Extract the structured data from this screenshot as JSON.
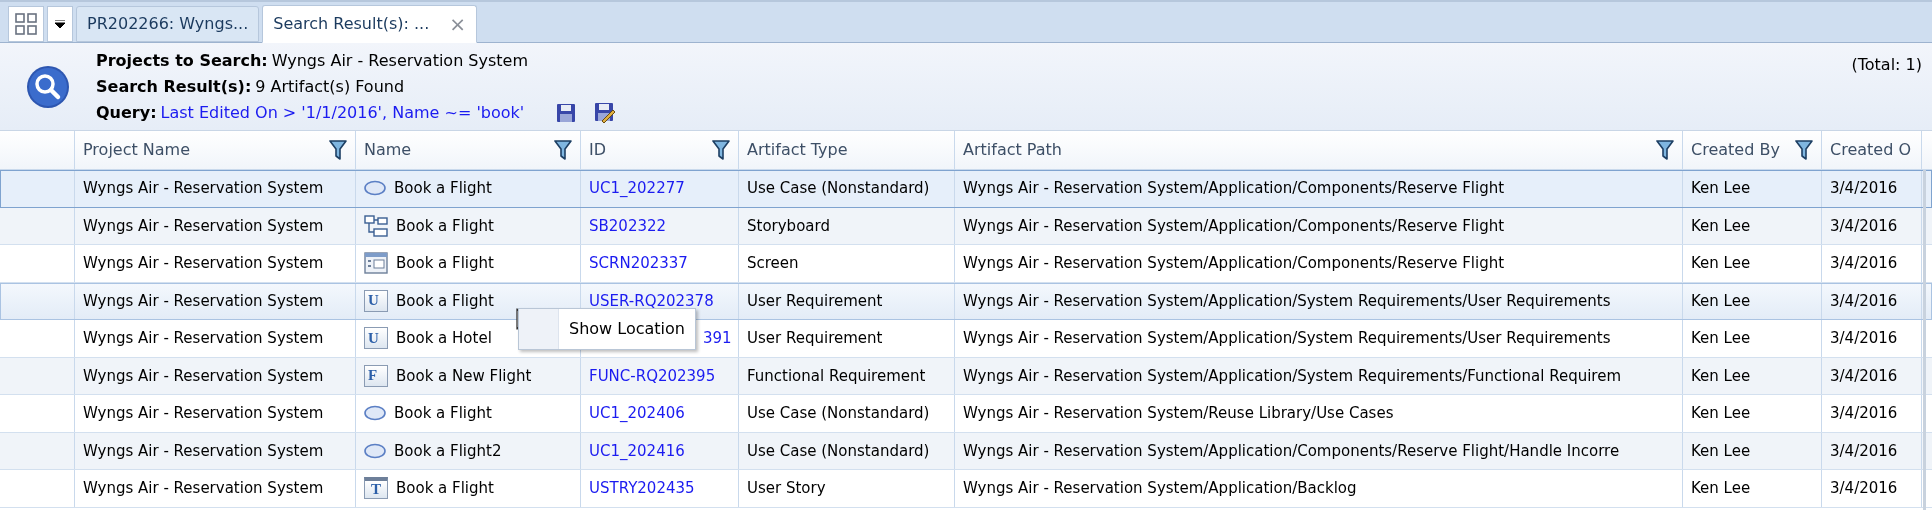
{
  "tabs": [
    {
      "label": "PR202266: Wyngs...",
      "selected": false,
      "closable": false
    },
    {
      "label": "Search Result(s): ...",
      "selected": true,
      "closable": true,
      "close": "×"
    }
  ],
  "summary": {
    "fields": [
      {
        "label": "Projects to Search:",
        "value": "Wyngs Air - Reservation System",
        "kind": "text"
      },
      {
        "label": "Search Result(s):",
        "value": "9 Artifact(s) Found",
        "kind": "text"
      },
      {
        "label": "Query:",
        "value": "Last Edited On > '1/1/2016', Name ~= 'book'",
        "kind": "query"
      }
    ],
    "total": "(Total: 1)"
  },
  "table": {
    "columns": [
      {
        "label": "Project Name",
        "filter": true
      },
      {
        "label": "Name",
        "filter": true
      },
      {
        "label": "ID",
        "filter": true
      },
      {
        "label": "Artifact Type",
        "filter": false
      },
      {
        "label": "Artifact Path",
        "filter": true
      },
      {
        "label": "Created By",
        "filter": true
      },
      {
        "label": "Created O",
        "filter": false
      }
    ],
    "rows": [
      {
        "selected": true,
        "highlighted": false,
        "project": "Wyngs Air - Reservation System",
        "kind": "use-case",
        "name": "Book a Flight",
        "id": "UC1_202277",
        "type": "Use Case (Nonstandard)",
        "path": "Wyngs Air - Reservation System/Application/Components/Reserve Flight",
        "created_by": "Ken Lee",
        "created_on": "3/4/2016"
      },
      {
        "selected": false,
        "highlighted": false,
        "project": "Wyngs Air - Reservation System",
        "kind": "storyboard",
        "name": "Book a Flight",
        "id": "SB202322",
        "type": "Storyboard",
        "path": "Wyngs Air - Reservation System/Application/Components/Reserve Flight",
        "created_by": "Ken Lee",
        "created_on": "3/4/2016"
      },
      {
        "selected": false,
        "highlighted": false,
        "project": "Wyngs Air - Reservation System",
        "kind": "screen",
        "name": "Book a Flight",
        "id": "SCRN202337",
        "type": "Screen",
        "path": "Wyngs Air - Reservation System/Application/Components/Reserve Flight",
        "created_by": "Ken Lee",
        "created_on": "3/4/2016"
      },
      {
        "selected": false,
        "highlighted": true,
        "project": "Wyngs Air - Reservation System",
        "kind": "letter",
        "icon_letter": "U",
        "name": "Book a Flight",
        "id": "USER-RQ202378",
        "type": "User Requirement",
        "path": "Wyngs Air - Reservation System/Application/System Requirements/User Requirements",
        "created_by": "Ken Lee",
        "created_on": "3/4/2016"
      },
      {
        "selected": false,
        "highlighted": false,
        "project": "Wyngs Air - Reservation System",
        "kind": "letter",
        "icon_letter": "U",
        "name": "Book a Hotel",
        "id": "391",
        "id_covered": true,
        "type": "User Requirement",
        "path": "Wyngs Air - Reservation System/Application/System Requirements/User Requirements",
        "created_by": "Ken Lee",
        "created_on": "3/4/2016"
      },
      {
        "selected": false,
        "highlighted": false,
        "project": "Wyngs Air - Reservation System",
        "kind": "letter",
        "icon_letter": "F",
        "name": "Book a New Flight",
        "id": "FUNC-RQ202395",
        "type": "Functional Requirement",
        "path": "Wyngs Air - Reservation System/Application/System Requirements/Functional Requirem",
        "created_by": "Ken Lee",
        "created_on": "3/4/2016"
      },
      {
        "selected": false,
        "highlighted": false,
        "project": "Wyngs Air - Reservation System",
        "kind": "use-case",
        "name": "Book a Flight",
        "id": "UC1_202406",
        "type": "Use Case (Nonstandard)",
        "path": "Wyngs Air - Reservation System/Reuse Library/Use Cases",
        "created_by": "Ken Lee",
        "created_on": "3/4/2016"
      },
      {
        "selected": false,
        "highlighted": false,
        "project": "Wyngs Air - Reservation System",
        "kind": "use-case",
        "name": "Book a Flight2",
        "id": "UC1_202416",
        "type": "Use Case (Nonstandard)",
        "path": "Wyngs Air - Reservation System/Application/Components/Reserve Flight/Handle Incorre",
        "created_by": "Ken Lee",
        "created_on": "3/4/2016"
      },
      {
        "selected": false,
        "highlighted": false,
        "project": "Wyngs Air - Reservation System",
        "kind": "story",
        "icon_letter": "T",
        "name": "Book a Flight",
        "id": "USTRY202435",
        "type": "User Story",
        "path": "Wyngs Air - Reservation System/Application/Backlog",
        "created_by": "Ken Lee",
        "created_on": "3/4/2016"
      }
    ]
  },
  "context_menu": {
    "items": [
      "Show Location"
    ]
  }
}
